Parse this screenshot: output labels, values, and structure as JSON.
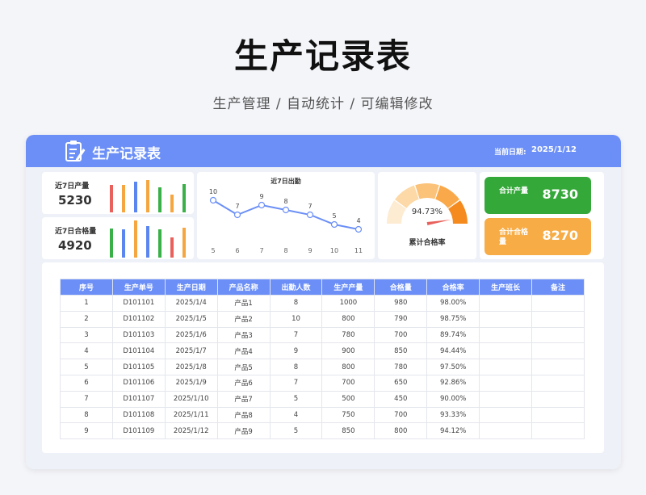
{
  "page": {
    "title": "生产记录表",
    "subtitle": "生产管理 / 自动统计 / 可编辑修改"
  },
  "header": {
    "title": "生产记录表",
    "icon": "clipboard-edit-icon",
    "date_label": "当前日期:",
    "date_value": "2025/1/12"
  },
  "kpis": {
    "output": {
      "label": "近7日产量",
      "value": "5230",
      "bars": [
        {
          "level": 0.74,
          "color": "#e8615c"
        },
        {
          "level": 0.74,
          "color": "#f5a640"
        },
        {
          "level": 0.82,
          "color": "#5b86f0"
        },
        {
          "level": 0.87,
          "color": "#f5a640"
        },
        {
          "level": 0.68,
          "color": "#3ab048"
        },
        {
          "level": 0.48,
          "color": "#f5a640"
        },
        {
          "level": 0.76,
          "color": "#3ab048"
        }
      ]
    },
    "qualified": {
      "label": "近7日合格量",
      "value": "4920",
      "bars": [
        {
          "level": 0.76,
          "color": "#3ab048"
        },
        {
          "level": 0.72,
          "color": "#5b86f0"
        },
        {
          "level": 0.96,
          "color": "#f5a640"
        },
        {
          "level": 0.82,
          "color": "#5b86f0"
        },
        {
          "level": 0.72,
          "color": "#3ab048"
        },
        {
          "level": 0.52,
          "color": "#e8615c"
        },
        {
          "level": 0.78,
          "color": "#f5a640"
        }
      ]
    }
  },
  "attendance_chart": {
    "title": "近7日出勤",
    "color": "#6b8ff7"
  },
  "chart_data": {
    "type": "line",
    "title": "近7日出勤",
    "x": [
      5,
      6,
      7,
      8,
      9,
      10,
      11
    ],
    "values": [
      10,
      7,
      9,
      8,
      7,
      5,
      4
    ],
    "ylim": [
      0,
      10
    ],
    "grid": false
  },
  "gauge": {
    "value": "94.73%",
    "fraction": 0.9473,
    "label": "累计合格率",
    "colors": [
      "#fdebd2",
      "#fcd9a6",
      "#fbc27a",
      "#f9a94a",
      "#f58a1f"
    ]
  },
  "summary": {
    "output": {
      "label": "合计产量",
      "value": "8730",
      "color": "#35a83a"
    },
    "qualified": {
      "label": "合计合格量",
      "value": "8270",
      "color": "#f7ac45"
    }
  },
  "table": {
    "headers": [
      "序号",
      "生产单号",
      "生产日期",
      "产品名称",
      "出勤人数",
      "生产产量",
      "合格量",
      "合格率",
      "生产班长",
      "备注"
    ],
    "rows": [
      [
        "1",
        "D101101",
        "2025/1/4",
        "产品1",
        "8",
        "1000",
        "980",
        "98.00%",
        "",
        ""
      ],
      [
        "2",
        "D101102",
        "2025/1/5",
        "产品2",
        "10",
        "800",
        "790",
        "98.75%",
        "",
        ""
      ],
      [
        "3",
        "D101103",
        "2025/1/6",
        "产品3",
        "7",
        "780",
        "700",
        "89.74%",
        "",
        ""
      ],
      [
        "4",
        "D101104",
        "2025/1/7",
        "产品4",
        "9",
        "900",
        "850",
        "94.44%",
        "",
        ""
      ],
      [
        "5",
        "D101105",
        "2025/1/8",
        "产品5",
        "8",
        "800",
        "780",
        "97.50%",
        "",
        ""
      ],
      [
        "6",
        "D101106",
        "2025/1/9",
        "产品6",
        "7",
        "700",
        "650",
        "92.86%",
        "",
        ""
      ],
      [
        "7",
        "D101107",
        "2025/1/10",
        "产品7",
        "5",
        "500",
        "450",
        "90.00%",
        "",
        ""
      ],
      [
        "8",
        "D101108",
        "2025/1/11",
        "产品8",
        "4",
        "750",
        "700",
        "93.33%",
        "",
        ""
      ],
      [
        "9",
        "D101109",
        "2025/1/12",
        "产品9",
        "5",
        "850",
        "800",
        "94.12%",
        "",
        ""
      ]
    ]
  }
}
